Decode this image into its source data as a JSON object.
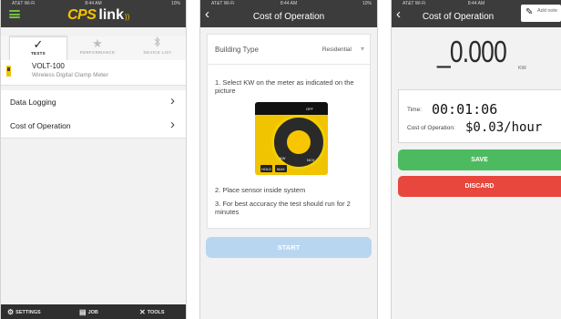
{
  "status": {
    "carrier": "AT&T Wi-Fi",
    "time": "8:44 AM",
    "battery": "10%"
  },
  "panel1": {
    "logo": {
      "cps": "CPS",
      "link": "link"
    },
    "tabs": [
      {
        "label": "TESTS",
        "icon": "check-icon"
      },
      {
        "label": "PERFORMANCE",
        "icon": "star-icon"
      },
      {
        "label": "DEVICE LIST",
        "icon": "bluetooth-icon"
      }
    ],
    "device": {
      "name": "VOLT-100",
      "description": "Wireless Digital Clamp Meter"
    },
    "menu": [
      {
        "label": "Data Logging"
      },
      {
        "label": "Cost of Operation"
      }
    ],
    "bottom_nav": [
      {
        "label": "SETTINGS",
        "icon": "gear-icon"
      },
      {
        "label": "JOB",
        "icon": "document-icon"
      },
      {
        "label": "TOOLS",
        "icon": "tools-icon"
      }
    ]
  },
  "panel2": {
    "title": "Cost of Operation",
    "building_type_label": "Building Type",
    "building_type_value": "Residential",
    "instructions": [
      "1. Select KW on the meter as indicated on the picture",
      "2. Place sensor inside system",
      "3. For best accuracy the test should run for 2 minutes"
    ],
    "meter_labels": {
      "off": "OFF",
      "kw": "KW",
      "ncv": "NCV",
      "hold": "HOLD",
      "max": "MAX"
    },
    "start_label": "START"
  },
  "panel3": {
    "title": "Cost of Operation",
    "add_note": "Add note",
    "reading_value": "_0.000",
    "reading_unit": "KW",
    "time_label": "Time:",
    "time_value": "00:01:06",
    "cost_label": "Cost of Operation:",
    "cost_value": "$0.03/hour",
    "save_label": "SAVE",
    "discard_label": "DISCARD"
  },
  "colors": {
    "navbar": "#3c3c3c",
    "brand_yellow": "#f7c300",
    "hamburger_green": "#73c043",
    "start_disabled": "#b9d6f1",
    "save_green": "#4cbb5f",
    "discard_red": "#e8473d"
  }
}
